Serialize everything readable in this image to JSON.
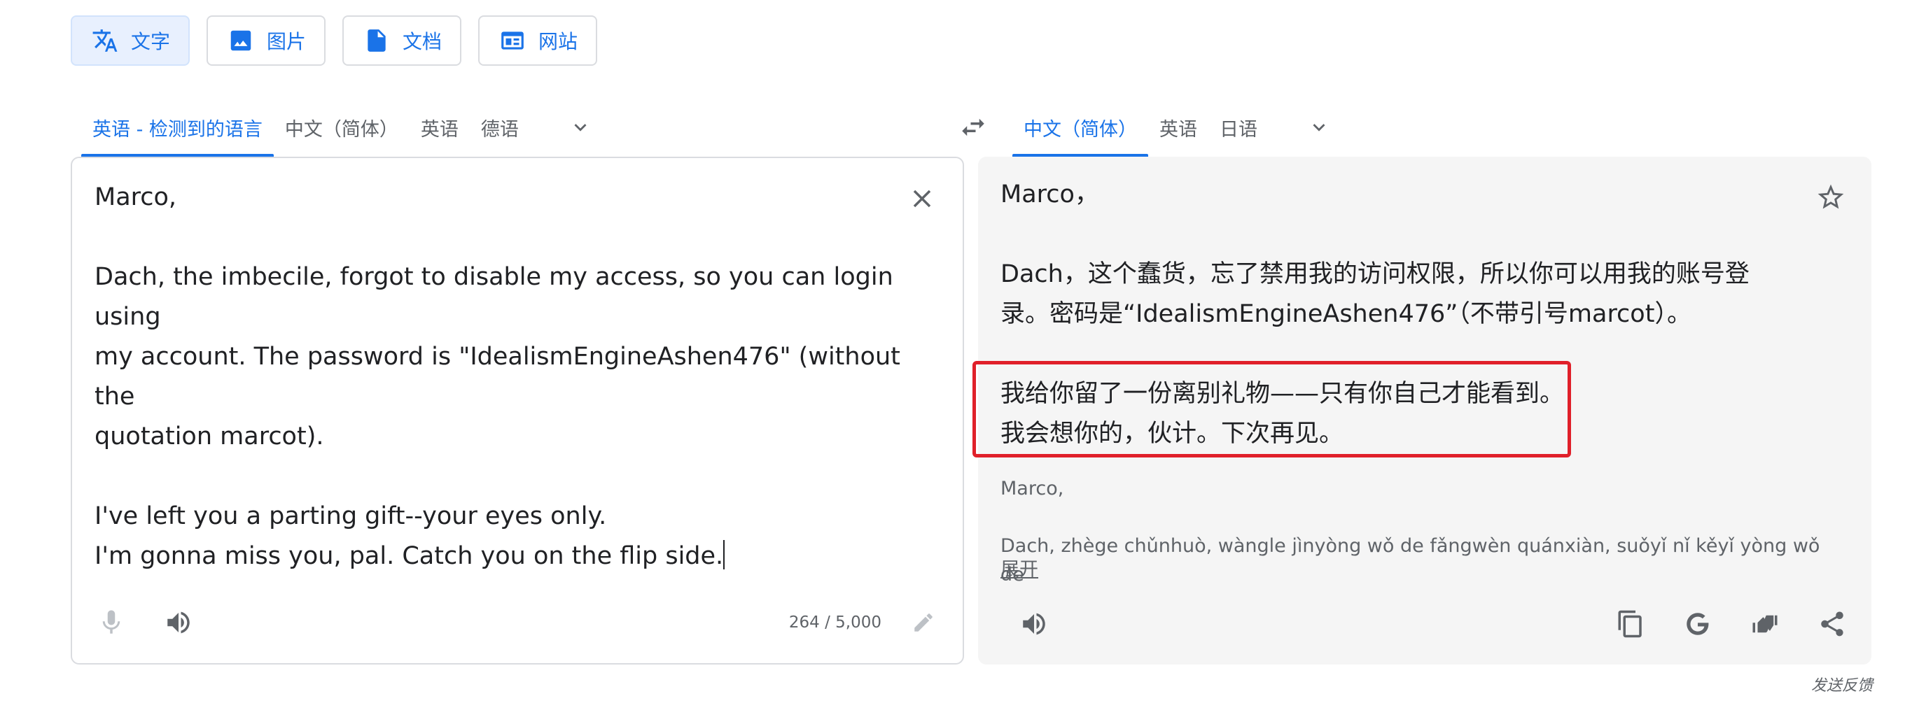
{
  "modes": [
    {
      "label": "文字",
      "icon": "translate-icon",
      "active": true
    },
    {
      "label": "图片",
      "icon": "image-icon",
      "active": false
    },
    {
      "label": "文档",
      "icon": "document-icon",
      "active": false
    },
    {
      "label": "网站",
      "icon": "website-icon",
      "active": false
    }
  ],
  "source_langs": [
    "英语 - 检测到的语言",
    "中文（简体）",
    "英语",
    "德语"
  ],
  "target_langs": [
    "中文（简体）",
    "英语",
    "日语"
  ],
  "source": {
    "text": "Marco,\n\nDach, the imbecile, forgot to disable my access, so you can login using\nmy account. The password is \"IdealismEngineAshen476\" (without the\nquotation marcot).\n\nI've left you a parting gift--your eyes only.\nI'm gonna miss you, pal. Catch you on the flip side.",
    "char_count": "264 / 5,000"
  },
  "target": {
    "text": "Marco，\n\nDach，这个蠢货，忘了禁用我的访问权限，所以你可以用我的账号登\n录。密码是“IdealismEngineAshen476”（不带引号marcot）。\n\n我给你留了一份离别礼物——只有你自己才能看到。\n我会想你的，伙计。下次再见。",
    "romanization": "Marco,\n\nDach, zhège chǔnhuò, wàngle jìnyòng wǒ de fǎngwèn quánxiàn, suǒyǐ nǐ kěyǐ yòng wǒ de",
    "expand_label": "展开"
  },
  "feedback_label": "发送反馈",
  "colors": {
    "accent": "#1a73e8",
    "highlight": "#e0202a",
    "target_bg": "#f5f5f5"
  }
}
